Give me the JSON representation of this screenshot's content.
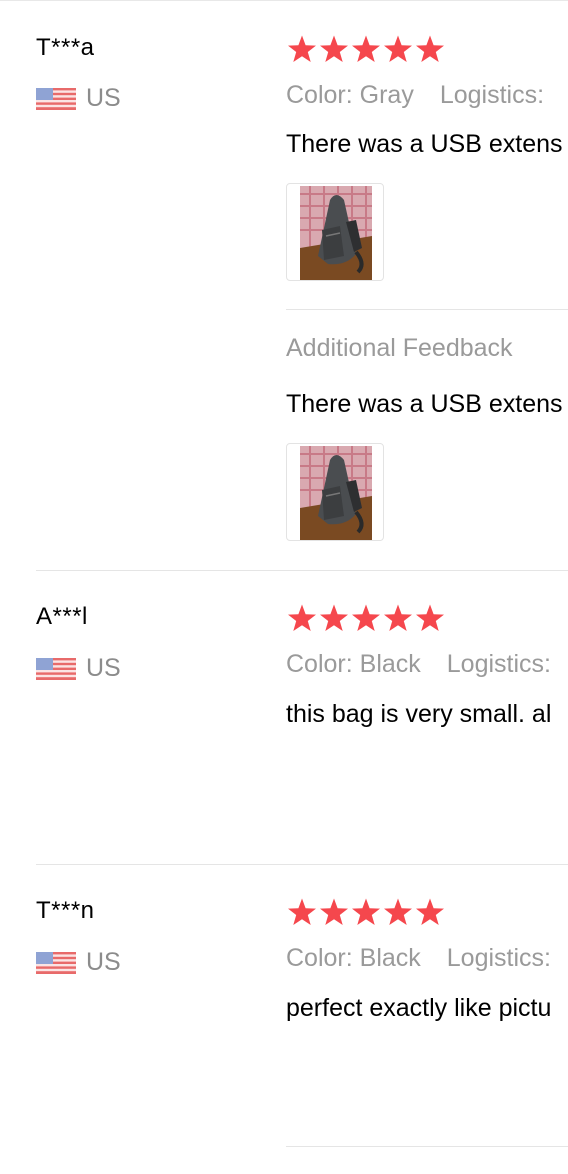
{
  "reviews": [
    {
      "user": "T***a",
      "country": "US",
      "flag_icon": "us-flag-icon",
      "rating": 5,
      "color_label": "Color:",
      "color_value": "Gray",
      "logistics_label": "Logistics:",
      "text": "There was a USB extens",
      "additional": {
        "title": "Additional Feedback",
        "text": "There was a USB extens"
      }
    },
    {
      "user": "A***l",
      "country": "US",
      "flag_icon": "us-flag-icon",
      "rating": 5,
      "color_label": "Color:",
      "color_value": "Black",
      "logistics_label": "Logistics:",
      "text": "this bag is very small. al"
    },
    {
      "user": "T***n",
      "country": "US",
      "flag_icon": "us-flag-icon",
      "rating": 5,
      "color_label": "Color:",
      "color_value": "Black",
      "logistics_label": "Logistics:",
      "text": "perfect exactly like pictu"
    }
  ],
  "colors": {
    "star": "#f5474d",
    "muted_text": "#9a9a9a",
    "divider": "#e5e5e5"
  }
}
